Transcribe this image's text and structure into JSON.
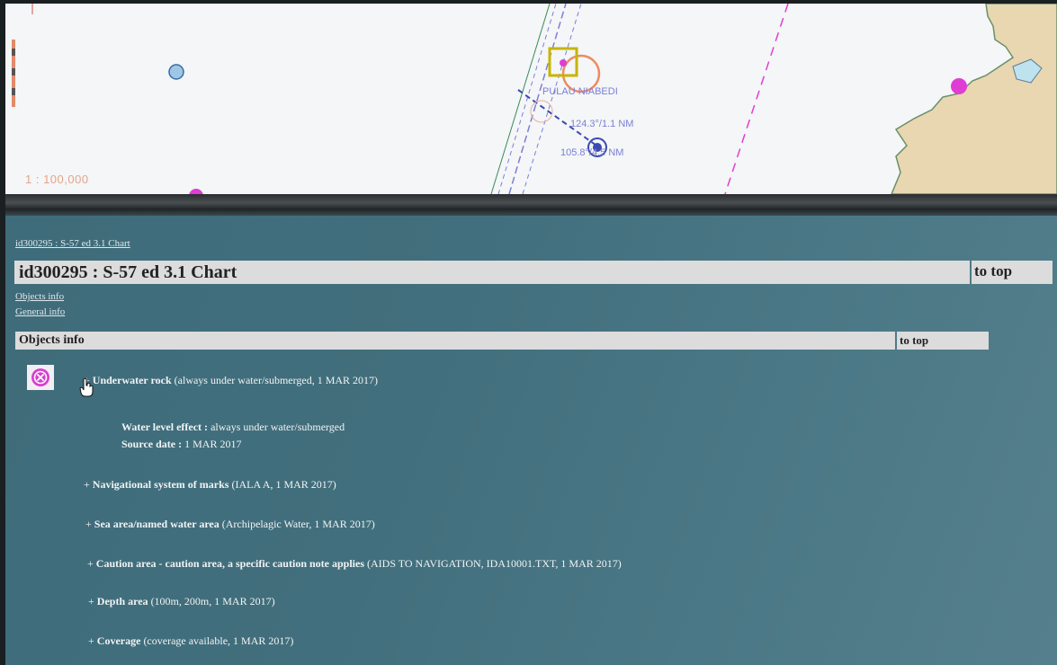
{
  "chart": {
    "scale": "1 : 100,000",
    "place_label": "PULAU NIABEDI",
    "bearing_1": "124.3°/1.1 NM",
    "bearing_2": "105.8°/4.5 NM",
    "colors": {
      "land": "#e8d7b0",
      "sea": "#f4f6f7",
      "route": "#e03dd4",
      "accent": "#ef8a62"
    }
  },
  "info": {
    "breadcrumb": "id300295 : S-57 ed 3.1 Chart",
    "title": "id300295 : S-57 ed 3.1 Chart",
    "to_top": "to top",
    "links": {
      "objects_info": "Objects info",
      "general_info": "General info"
    },
    "section_title": "Objects info",
    "section_to_top": "to top",
    "icons": {
      "rock": "underwater-rock-icon",
      "cursor": "hand-cursor-icon"
    },
    "objects": [
      {
        "prefix": "+ ",
        "name": "Underwater rock",
        "detail": " (always under water/submerged, 1 MAR 2017)"
      },
      {
        "prefix": "+ ",
        "name": "Navigational system of marks",
        "detail": " (IALA A, 1 MAR 2017)"
      },
      {
        "prefix": "+ ",
        "name": "Sea area/named water area",
        "detail": " (Archipelagic Water, 1 MAR 2017)"
      },
      {
        "prefix": "+ ",
        "name": "Caution area - caution area, a specific caution note applies",
        "detail": " (AIDS TO NAVIGATION, IDA10001.TXT, 1 MAR 2017)"
      },
      {
        "prefix": "+ ",
        "name": "Depth area",
        "detail": " (100m, 200m, 1 MAR 2017)"
      },
      {
        "prefix": "+ ",
        "name": "Coverage",
        "detail": " (coverage available, 1 MAR 2017)"
      }
    ],
    "rock_details": [
      {
        "label": "Water level effect : ",
        "value": "always under water/submerged"
      },
      {
        "label": "Source date : ",
        "value": "1 MAR 2017"
      }
    ]
  }
}
